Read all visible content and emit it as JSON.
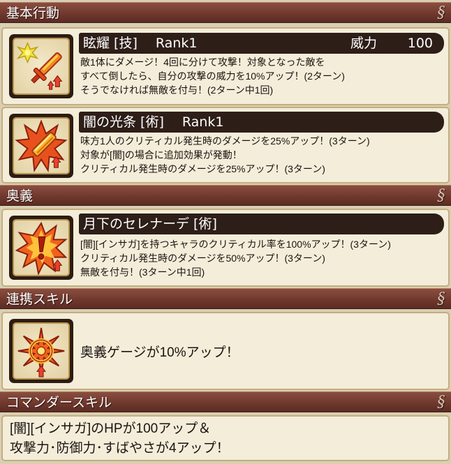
{
  "sections": {
    "basic": "基本行動",
    "ougi": "奥義",
    "renkei": "連携スキル",
    "commander": "コマンダースキル"
  },
  "skill1": {
    "name": "眩耀 [技]",
    "rank": "Rank1",
    "power_label": "威力",
    "power_value": "100",
    "lines": [
      "敵1体にダメージ！4回に分けて攻撃！対象となった敵を",
      "すべて倒したら、自分の攻撃の威力を10%アップ！(2ターン)",
      "そうでなければ無敵を付与！(2ターン中1回)"
    ],
    "icon": "sword-burst-icon"
  },
  "skill2": {
    "name": "闇の光条 [術]",
    "rank": "Rank1",
    "lines": [
      "味方1人のクリティカル発生時のダメージを25%アップ！(3ターン)",
      "対象が[闇]の場合に追加効果が発動！",
      "クリティカル発生時のダメージを25%アップ！(3ターン)"
    ],
    "icon": "flame-sword-icon"
  },
  "ougi": {
    "name": "月下のセレナーデ [術]",
    "lines": [
      "[闇][インサガ]を持つキャラのクリティカル率を100%アップ！(3ターン)",
      "クリティカル発生時のダメージを50%アップ！(3ターン)",
      "無敵を付与！(3ターン中1回)"
    ],
    "icon": "exclamation-burst-icon"
  },
  "renkei": {
    "text": "奥義ゲージが10%アップ！",
    "icon": "compass-star-icon"
  },
  "commander": {
    "lines": [
      "[闇][インサガ]のHPが100アップ＆",
      "攻撃力･防御力･すばやさが4アップ！"
    ]
  },
  "colors": {
    "header": "#6e372c",
    "titlebar": "#2e1e18",
    "card": "#f3edda",
    "border": "#c4ae7c"
  }
}
